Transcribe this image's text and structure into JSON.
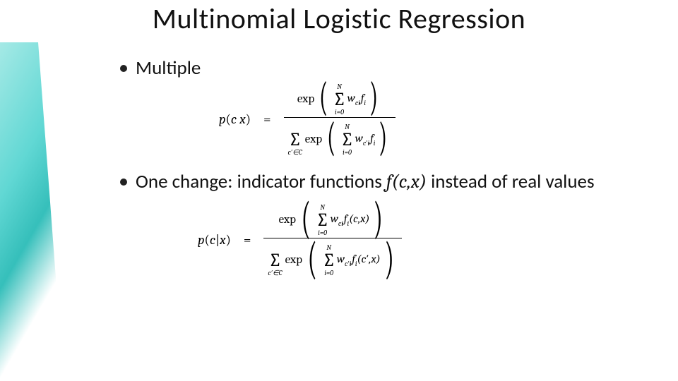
{
  "title": "Multinomial Logistic Regression",
  "bullets": {
    "b1": "Multiple",
    "b2a": "One change: indicator functions ",
    "b2b": "f(c,x)",
    "b2c": " instead of real values"
  },
  "eq": {
    "lhs1": "p(c x)",
    "lhs2": "p(c|x)",
    "eq": "=",
    "exp": "exp",
    "N": "N",
    "i0": "i=0",
    "cinC": "c′∈C",
    "t_wci_fi": "w_{ci} f_i",
    "t_wcpi_fi": "w_{c′i} f_i",
    "t_wci_fi_cx": "w_{ci} f_i(c,x)",
    "t_wcpi_fi_cpx": "w_{c′i} f_i(c′,x)"
  }
}
